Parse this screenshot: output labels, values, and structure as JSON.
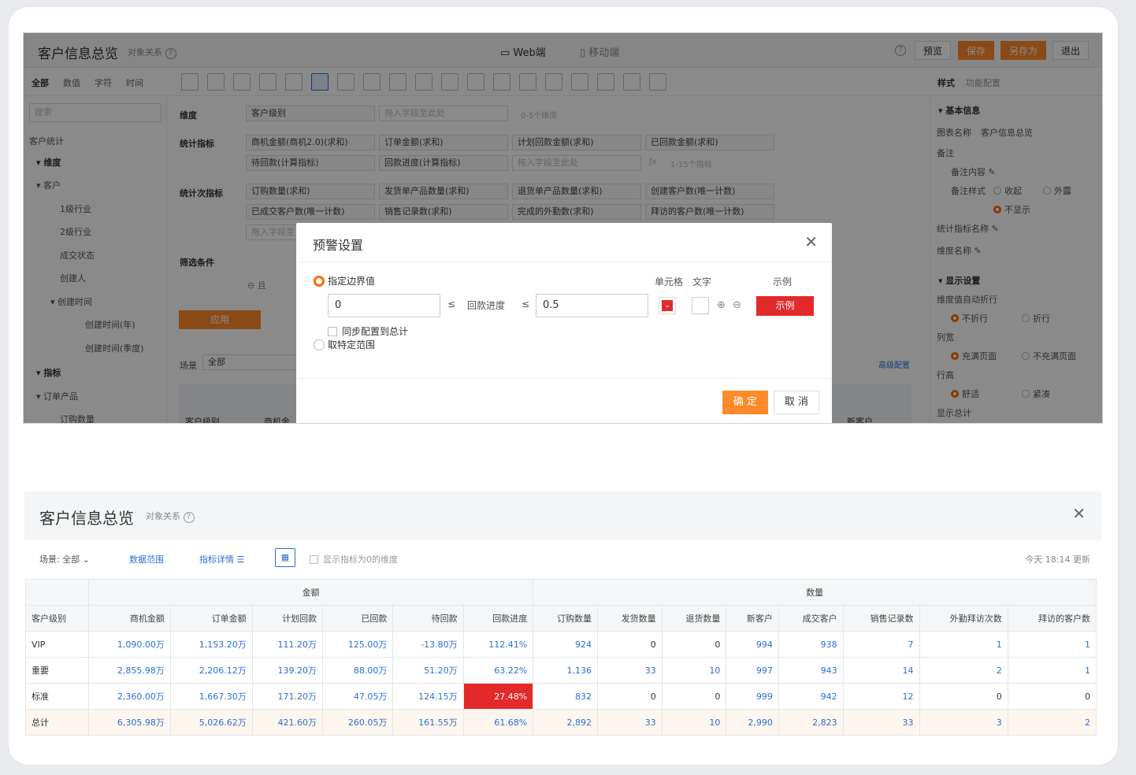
{
  "designer": {
    "title": "客户信息总览",
    "relation": "对象关系",
    "help": "?",
    "web_label": "Web端",
    "mobile_label": "移动端",
    "buttons": [
      "预览",
      "保存",
      "另存为",
      "退出"
    ],
    "field_tabs": [
      "全部",
      "数值",
      "字符",
      "时间"
    ],
    "search_placeholder": "搜索",
    "tree": [
      "客户统计",
      "维度",
      "客户",
      "1级行业",
      "2级行业",
      "成交状态",
      "创建人",
      "创建时间",
      "创建时间(年)",
      "创建时间(季度)",
      "指标",
      "订单产品",
      "订购数量"
    ],
    "sections": {
      "dimension": "维度",
      "stat": "统计指标",
      "count_stat": "统计次指标",
      "filter": "筛选条件",
      "scene": "场景",
      "scene_val": "全部",
      "advanced": "高级配置",
      "apply": "应用"
    },
    "dim_fields": [
      "客户级别",
      "拖入字段至此处",
      "0-5个维度"
    ],
    "stat_fields": [
      "商机金额(商机2.0)(求和)",
      "订单金额(求和)",
      "计划回款金额(求和)",
      "已回款金额(求和)",
      "待回款(计算指标)",
      "回款进度(计算指标)",
      "拖入字段至此处",
      "1-15个指标"
    ],
    "count_fields": [
      "订购数量(求和)",
      "发货单产品数量(求和)",
      "退货单产品数量(求和)",
      "创建客户数(唯一计数)",
      "已成交客户数(唯一计数)",
      "销售记录数(求和)",
      "完成的外勤数(求和)",
      "拜访的客户数(唯一计数)",
      "拖入字段至"
    ],
    "filter_and": "且",
    "table_cols": [
      "客户级别",
      "商机金",
      "新客户"
    ],
    "right": {
      "tab_style": "样式",
      "tab_func": "功能配置",
      "basic": "基本信息",
      "chart_name_label": "图表名称",
      "chart_name": "客户信息总览",
      "note": "备注",
      "note_content": "备注内容",
      "note_style": "备注样式",
      "collapse": "收起",
      "outside": "外露",
      "hide": "不显示",
      "stat_name": "统计指标名称",
      "dim_name": "维度名称",
      "display": "显示设置",
      "autowrap": "维度值自动折行",
      "nowrap": "不折行",
      "wrap": "折行",
      "colwidth": "列宽",
      "fill": "充满页面",
      "nofill": "不充满页面",
      "rowh": "行高",
      "comfort": "舒适",
      "compact": "紧凑",
      "show_total": "显示总计"
    }
  },
  "modal": {
    "title": "预警设置",
    "opt1": "指定边界值",
    "opt2": "取特定范围",
    "min": "0",
    "le": "≤",
    "metric": "回款进度",
    "max": "0.5",
    "cell": "单元格",
    "text": "文字",
    "example": "示例",
    "sample": "示例",
    "sync": "同步配置到总计",
    "ok": "确 定",
    "cancel": "取 消"
  },
  "report": {
    "title": "客户信息总览",
    "relation": "对象关系",
    "scene_label": "场景:",
    "scene_val": "全部",
    "data_range": "数据范围",
    "metric_detail": "指标详情",
    "show_zero": "显示指标为0的维度",
    "update": "今天 18:14 更新",
    "group1": "金额",
    "group2": "数量",
    "headers": [
      "客户级别",
      "商机金额",
      "订单金额",
      "计划回款",
      "已回款",
      "待回款",
      "回款进度",
      "订购数量",
      "发货数量",
      "退货数量",
      "新客户",
      "成交客户",
      "销售记录数",
      "外勤拜访次数",
      "拜访的客户数"
    ],
    "rows": [
      [
        "VIP",
        "1,090.00万",
        "1,153.20万",
        "111.20万",
        "125.00万",
        "-13.80万",
        "112.41%",
        "924",
        "0",
        "0",
        "994",
        "938",
        "7",
        "1",
        "1"
      ],
      [
        "重要",
        "2,855.98万",
        "2,206.12万",
        "139.20万",
        "88.00万",
        "51.20万",
        "63.22%",
        "1,136",
        "33",
        "10",
        "997",
        "943",
        "14",
        "2",
        "1"
      ],
      [
        "标准",
        "2,360.00万",
        "1,667.30万",
        "171.20万",
        "47.05万",
        "124.15万",
        "27.48%",
        "832",
        "0",
        "0",
        "999",
        "942",
        "12",
        "0",
        "0"
      ],
      [
        "总计",
        "6,305.98万",
        "5,026.62万",
        "421.60万",
        "260.05万",
        "161.55万",
        "61.68%",
        "2,892",
        "33",
        "10",
        "2,990",
        "2,823",
        "33",
        "3",
        "2"
      ]
    ]
  },
  "colors": {
    "accent": "#ff8a2b",
    "alert": "#e22a2a",
    "link": "#2b6fd6"
  }
}
